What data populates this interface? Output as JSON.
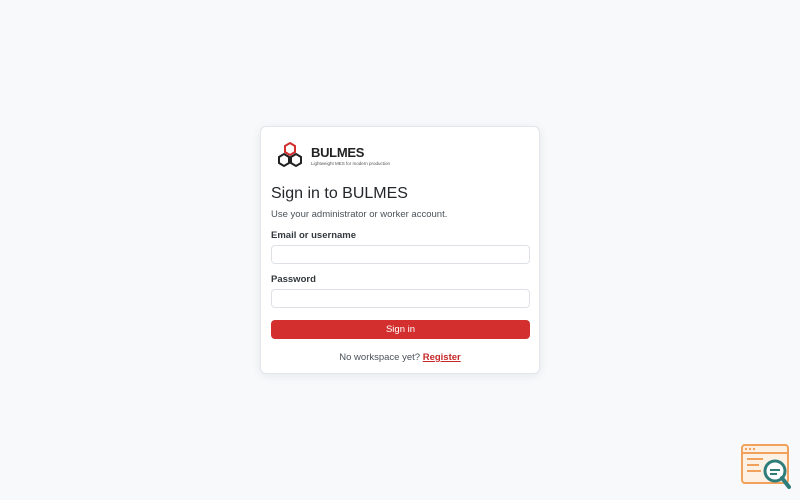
{
  "brand": {
    "name": "BULMES",
    "tagline": "Lightweight MES for modern production",
    "logo_icon": "hexagon-cluster-icon",
    "logo_color": "#d32f2f"
  },
  "login": {
    "title": "Sign in to BULMES",
    "subtitle": "Use your administrator or worker account.",
    "email_label": "Email or username",
    "email_value": "",
    "password_label": "Password",
    "password_value": "",
    "submit_label": "Sign in",
    "footer_text": "No workspace yet?",
    "register_label": "Register"
  },
  "colors": {
    "accent": "#d32f2f",
    "background": "#f7f9fb",
    "widget_orange": "#f0a15c",
    "widget_teal": "#2f7d7a"
  },
  "widget": {
    "icon": "search-browser-icon"
  }
}
